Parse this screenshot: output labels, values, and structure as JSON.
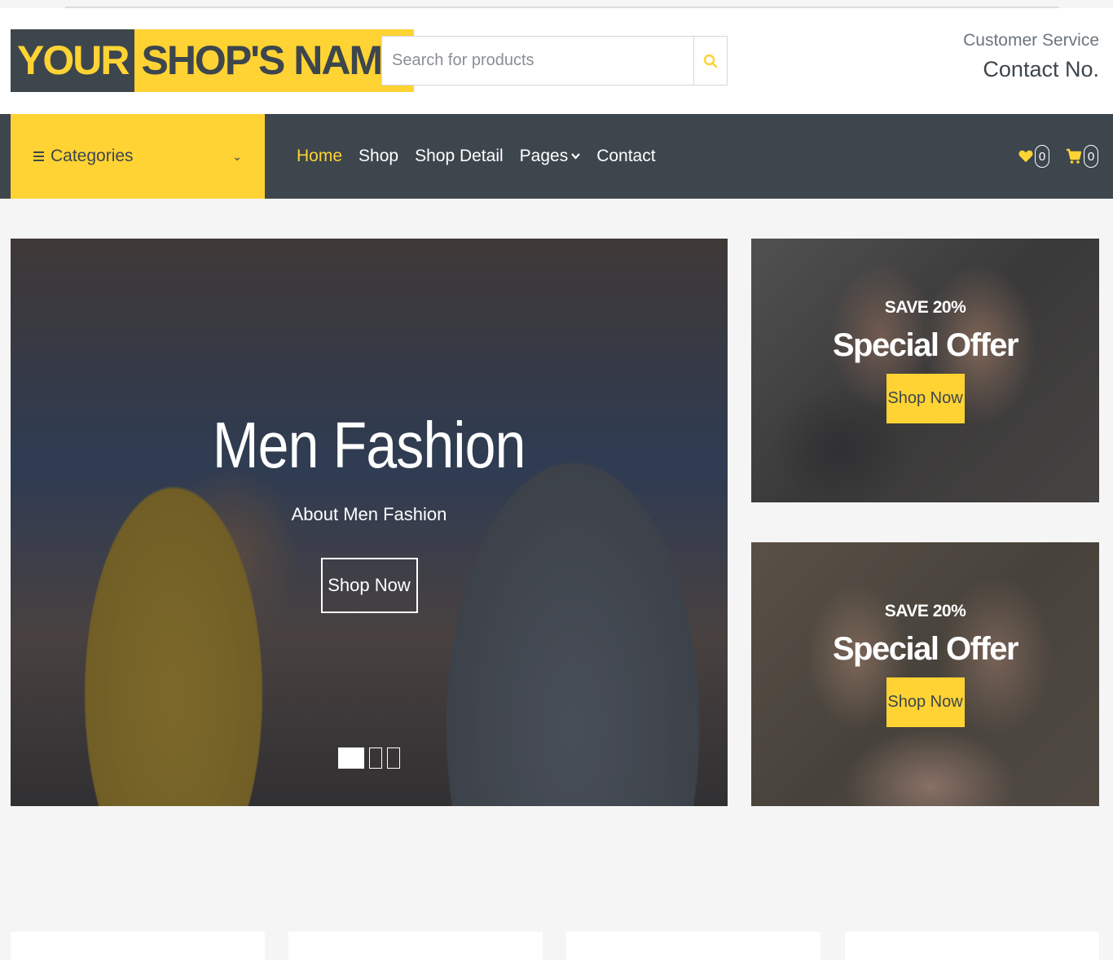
{
  "logo": {
    "part1": "YOUR",
    "part2": "SHOP'S NAME"
  },
  "search": {
    "placeholder": "Search for products",
    "icon": "search-icon"
  },
  "service": {
    "label": "Customer Service",
    "contact": "Contact No."
  },
  "navbar": {
    "categories_label": "Categories",
    "links": [
      "Home",
      "Shop",
      "Shop Detail",
      "Pages",
      "Contact"
    ],
    "active": "Home",
    "wishlist_count": "0",
    "cart_count": "0"
  },
  "hero": {
    "title": "Men Fashion",
    "subtitle": "About Men Fashion",
    "button": "Shop Now",
    "slide_count": 3,
    "active_slide": 1
  },
  "offers": [
    {
      "save": "SAVE 20%",
      "title": "Special Offer",
      "button": "Shop Now"
    },
    {
      "save": "SAVE 20%",
      "title": "Special Offer",
      "button": "Shop Now"
    }
  ],
  "colors": {
    "primary": "#ffd333",
    "dark": "#3d464d",
    "background": "#f5f5f5"
  }
}
